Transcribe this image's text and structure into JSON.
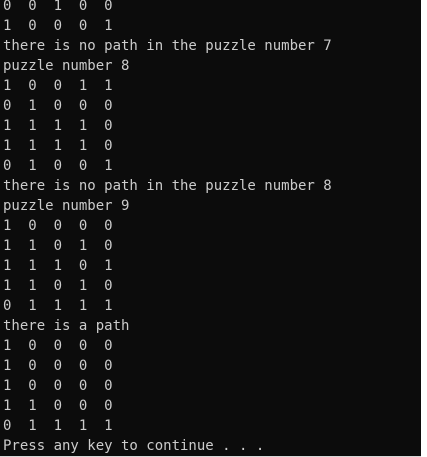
{
  "console": {
    "lines": [
      "0  0  1  0  0",
      "1  0  0  0  1",
      "there is no path in the puzzle number 7",
      "puzzle number 8",
      "1  0  0  1  1",
      "0  1  0  0  0",
      "1  1  1  1  0",
      "1  1  1  1  0",
      "0  1  0  0  1",
      "there is no path in the puzzle number 8",
      "puzzle number 9",
      "1  0  0  0  0",
      "1  1  0  1  0",
      "1  1  1  0  1",
      "1  1  0  1  0",
      "0  1  1  1  1",
      "there is a path",
      "1  0  0  0  0",
      "1  0  0  0  0",
      "1  0  0  0  0",
      "1  1  0  0  0",
      "0  1  1  1  1",
      "Press any key to continue . . ."
    ]
  }
}
